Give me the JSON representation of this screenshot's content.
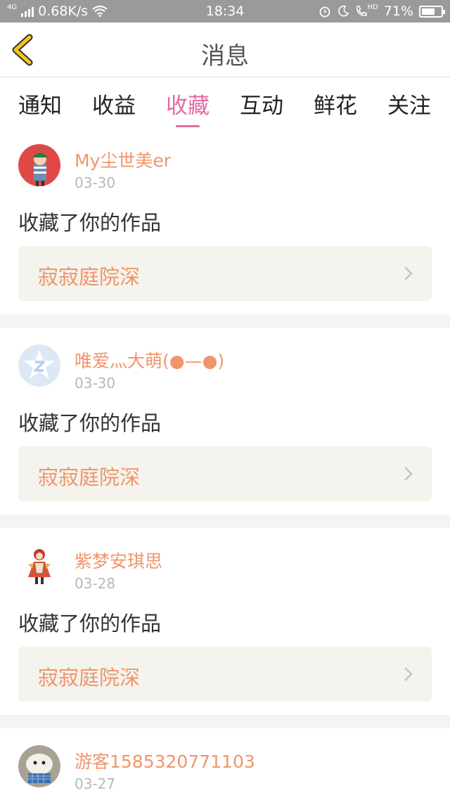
{
  "status_bar": {
    "network_label": "4G",
    "speed": "0.68K/s",
    "time": "18:34",
    "hd_label": "HD",
    "battery_text": "71%",
    "battery_level": 0.71,
    "icons": [
      "signal-icon",
      "wifi-icon",
      "alarm-icon",
      "moon-icon",
      "call-icon",
      "battery-icon"
    ]
  },
  "nav": {
    "title": "消息",
    "back_icon": "chevron-left-icon"
  },
  "tabs": [
    {
      "label": "通知",
      "active": false
    },
    {
      "label": "收益",
      "active": false
    },
    {
      "label": "收藏",
      "active": true
    },
    {
      "label": "互动",
      "active": false
    },
    {
      "label": "鲜花",
      "active": false
    },
    {
      "label": "关注",
      "active": false
    }
  ],
  "notifications": [
    {
      "user": "My尘世美er",
      "date": "03-30",
      "action": "收藏了你的作品",
      "work": "寂寂庭院深"
    },
    {
      "user": "唯爱灬大萌(●—●)",
      "date": "03-30",
      "action": "收藏了你的作品",
      "work": "寂寂庭院深"
    },
    {
      "user": "紫梦安琪思",
      "date": "03-28",
      "action": "收藏了你的作品",
      "work": "寂寂庭院深"
    },
    {
      "user": "游客1585320771103",
      "date": "03-27"
    }
  ],
  "colors": {
    "accent": "#e36aa0",
    "username": "#f0956b",
    "back_icon": "#f5c518",
    "status_bar": "#9a9a9a"
  }
}
